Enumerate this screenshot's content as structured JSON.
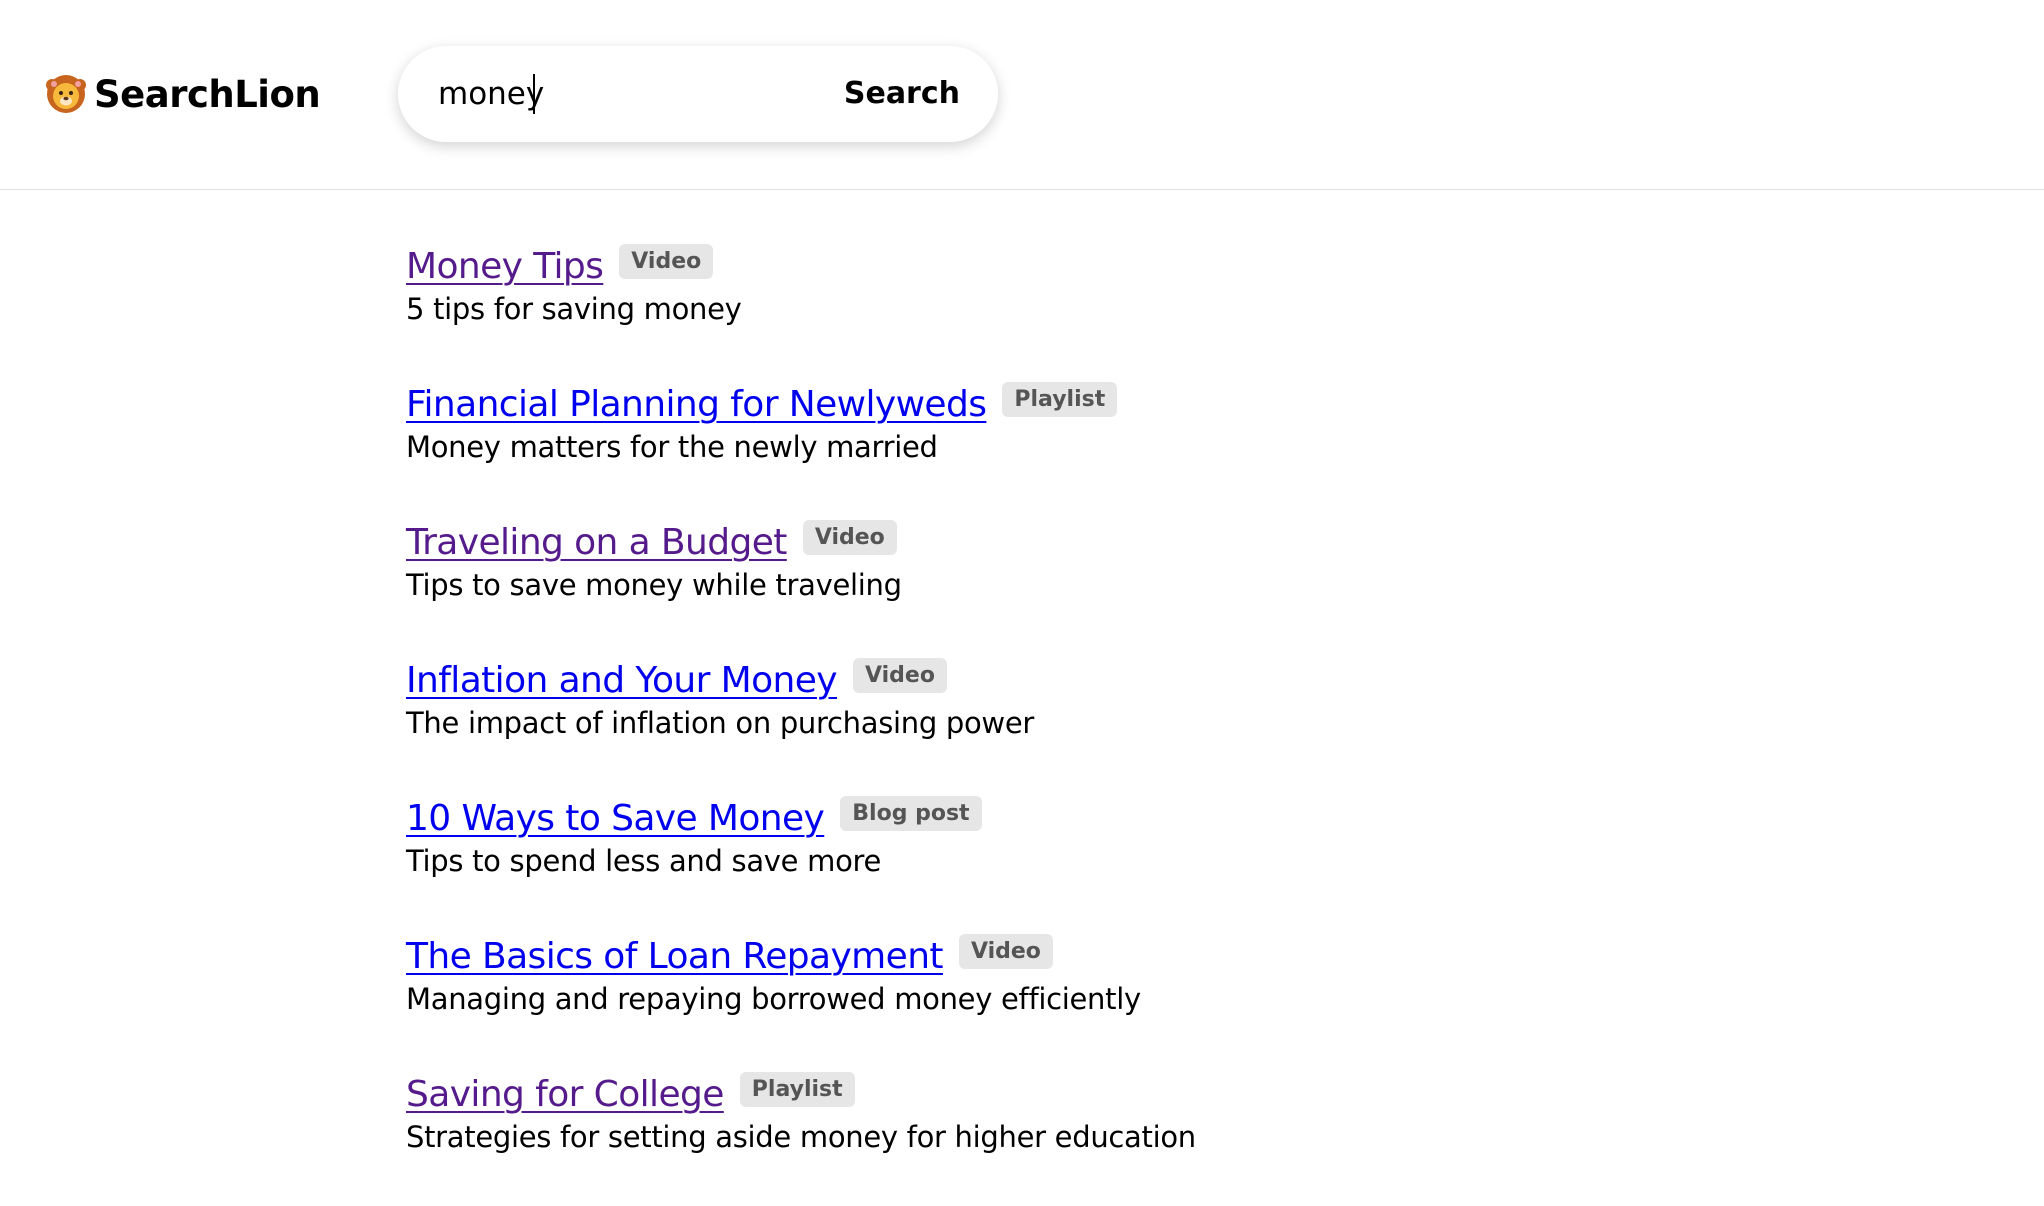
{
  "app": {
    "name": "SearchLion",
    "logo_icon": "lion-face-icon"
  },
  "search": {
    "value": "money",
    "button_label": "Search"
  },
  "results": [
    {
      "title": "Money Tips",
      "badge": "Video",
      "description": "5 tips for saving money",
      "visited": true
    },
    {
      "title": "Financial Planning for Newlyweds",
      "badge": "Playlist",
      "description": "Money matters for the newly married",
      "visited": false
    },
    {
      "title": "Traveling on a Budget",
      "badge": "Video",
      "description": "Tips to save money while traveling",
      "visited": true
    },
    {
      "title": "Inflation and Your Money",
      "badge": "Video",
      "description": "The impact of inflation on purchasing power",
      "visited": false
    },
    {
      "title": "10 Ways to Save Money",
      "badge": "Blog post",
      "description": "Tips to spend less and save more",
      "visited": false
    },
    {
      "title": "The Basics of Loan Repayment",
      "badge": "Video",
      "description": "Managing and repaying borrowed money efficiently",
      "visited": false
    },
    {
      "title": "Saving for College",
      "badge": "Playlist",
      "description": "Strategies for setting aside money for higher education",
      "visited": true
    }
  ],
  "colors": {
    "link_unvisited": "#0000ee",
    "link_visited": "#551a8b",
    "badge_bg": "#e6e6e6",
    "badge_text": "#555555"
  }
}
